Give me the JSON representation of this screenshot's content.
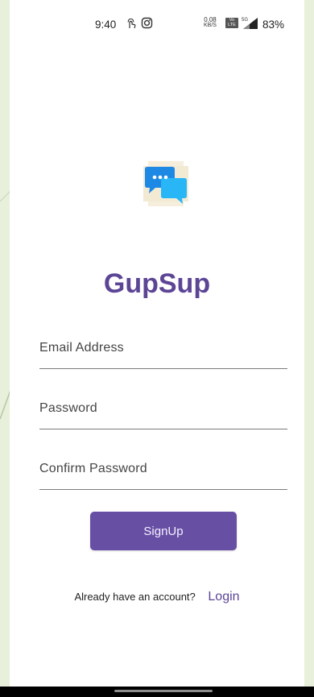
{
  "status_bar": {
    "time": "9:40",
    "net_speed_value": "0.08",
    "net_speed_unit": "KB/S",
    "volte_top": "Vo",
    "volte_bottom": "LTE",
    "network_type": "5G",
    "battery": "83%"
  },
  "app": {
    "title": "GupSup",
    "logo_icon": "chat-bubbles-icon"
  },
  "form": {
    "email_placeholder": "Email Address",
    "password_placeholder": "Password",
    "confirm_password_placeholder": "Confirm Password",
    "signup_label": "SignUp"
  },
  "footer": {
    "prompt": "Already have an account?",
    "login_label": "Login"
  },
  "colors": {
    "brand": "#5d4596",
    "button": "#6750a4",
    "logo_blue": "#1e88e5",
    "logo_cyan": "#29b6f6"
  }
}
